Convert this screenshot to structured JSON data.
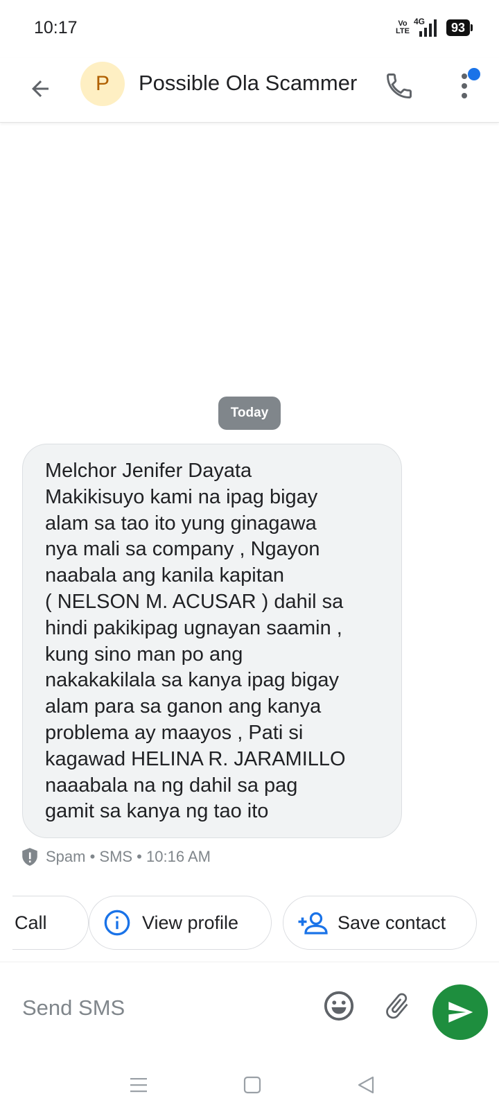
{
  "status_bar": {
    "time": "10:17",
    "volte_top": "Vo",
    "volte_bottom": "LTE",
    "network": "4G",
    "battery": "93"
  },
  "header": {
    "avatar_letter": "P",
    "contact_name": "Possible Ola Scammer",
    "back_icon": "arrow-left-icon",
    "call_icon": "phone-icon",
    "more_icon": "more-vert-icon"
  },
  "conversation": {
    "date_label": "Today",
    "message_lines": [
      "Melchor Jenifer Dayata",
      "Makikisuyo kami na ipag bigay",
      "alam sa tao ito yung ginagawa",
      "nya mali sa company , Ngayon",
      "naabala ang kanila kapitan",
      "( NELSON M. ACUSAR ) dahil sa",
      "hindi pakikipag ugnayan saamin ,",
      "kung sino man po ang",
      "nakakakilala sa kanya ipag bigay",
      "alam para sa ganon ang kanya",
      "problema ay maayos , Pati si",
      "kagawad HELINA R. JARAMILLO",
      "naaabala na ng dahil sa pag",
      "gamit sa kanya ng tao ito"
    ],
    "meta": "Spam • SMS • 10:16 AM"
  },
  "suggestions": {
    "call_label": "Call",
    "view_profile_label": "View profile",
    "save_contact_label": "Save contact"
  },
  "composer": {
    "placeholder": "Send SMS",
    "value": ""
  },
  "colors": {
    "accent_blue": "#1a73e8",
    "send_green": "#1e8e3e",
    "avatar_bg": "#feefc3",
    "avatar_fg": "#b06000",
    "bubble_bg": "#f1f3f4",
    "chip_gray": "#80868b"
  }
}
